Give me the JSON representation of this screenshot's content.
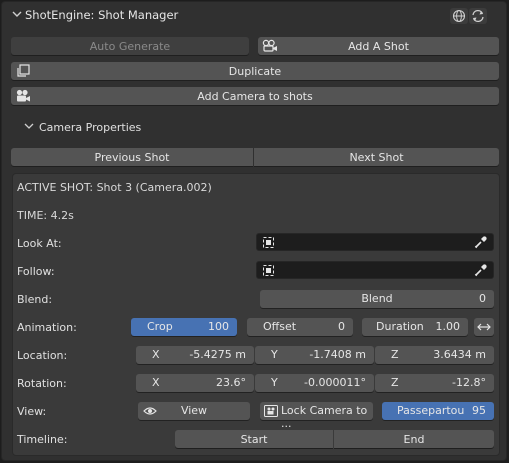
{
  "header": {
    "title": "ShotEngine: Shot Manager",
    "icons": [
      "globe-icon",
      "refresh-icon"
    ]
  },
  "toolbar": {
    "auto_generate": "Auto Generate",
    "add_shot": "Add A Shot",
    "duplicate": "Duplicate",
    "add_camera": "Add Camera to shots"
  },
  "camera_properties": {
    "title": "Camera Properties",
    "previous_shot": "Previous Shot",
    "next_shot": "Next Shot",
    "active_shot": "ACTIVE SHOT: Shot 3 (Camera.002)",
    "time": "TIME: 4.2s",
    "look_at": {
      "label": "Look At:",
      "value": ""
    },
    "follow": {
      "label": "Follow:",
      "value": ""
    },
    "blend": {
      "label": "Blend:",
      "name": "Blend",
      "value": "0"
    },
    "animation": {
      "label": "Animation:",
      "crop": {
        "name": "Crop",
        "value": "100",
        "active": true
      },
      "offset": {
        "name": "Offset",
        "value": "0"
      },
      "duration": {
        "name": "Duration",
        "value": "1.00"
      }
    },
    "location": {
      "label": "Location:",
      "x": {
        "axis": "X",
        "value": "-5.4275 m"
      },
      "y": {
        "axis": "Y",
        "value": "-1.7408 m"
      },
      "z": {
        "axis": "Z",
        "value": "3.6434 m"
      }
    },
    "rotation": {
      "label": "Rotation:",
      "x": {
        "axis": "X",
        "value": "23.6°"
      },
      "y": {
        "axis": "Y",
        "value": "-0.000011°"
      },
      "z": {
        "axis": "Z",
        "value": "-12.8°"
      }
    },
    "view": {
      "label": "View:",
      "view_button": "View",
      "lock_camera": "Lock Camera to ...",
      "passepartout": {
        "name": "Passepartou",
        "value": "95"
      }
    },
    "timeline": {
      "label": "Timeline:",
      "start": "Start",
      "end": "End"
    }
  },
  "colors": {
    "panel_bg": "#303030",
    "button": "#545454",
    "accent": "#4772b3",
    "field": "#1d1d1d"
  }
}
